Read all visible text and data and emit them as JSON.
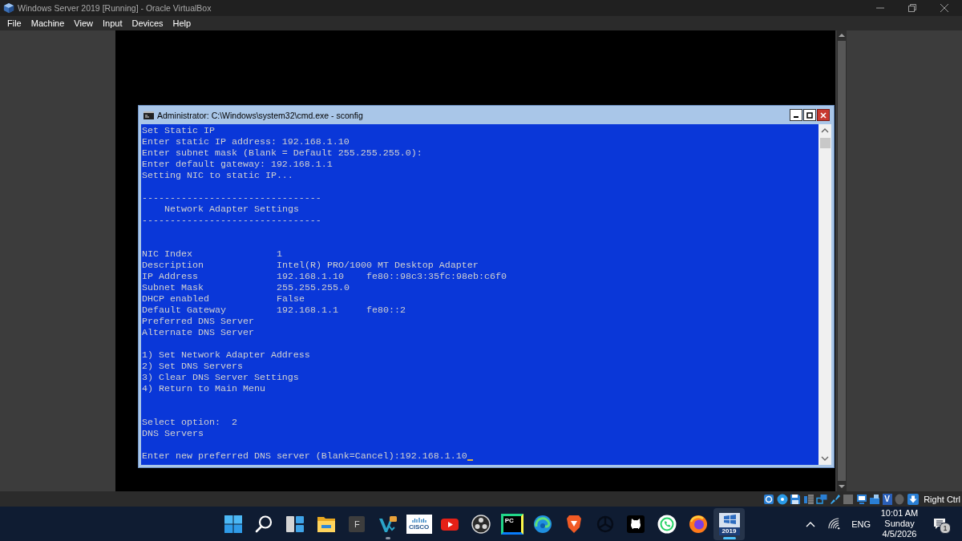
{
  "window": {
    "title": "Windows Server 2019 [Running] - Oracle VirtualBox"
  },
  "menu": [
    "File",
    "Machine",
    "View",
    "Input",
    "Devices",
    "Help"
  ],
  "console_window": {
    "title": "Administrator: C:\\Windows\\system32\\cmd.exe - sconfig",
    "intro_lines": [
      "Set Static IP",
      "Enter static IP address: 192.168.1.10",
      "Enter subnet mask (Blank = Default 255.255.255.0):",
      "Enter default gateway: 192.168.1.1",
      "Setting NIC to static IP..."
    ],
    "section": {
      "rule_top": "--------------------------------",
      "heading": "Network Adapter Settings",
      "rule_bottom": "--------------------------------"
    },
    "settings": [
      {
        "label": "NIC Index",
        "values": [
          "1"
        ]
      },
      {
        "label": "Description",
        "values": [
          "Intel(R) PRO/1000 MT Desktop Adapter"
        ]
      },
      {
        "label": "IP Address",
        "values": [
          "192.168.1.10",
          "fe80::98c3:35fc:98eb:c6f0"
        ]
      },
      {
        "label": "Subnet Mask",
        "values": [
          "255.255.255.0"
        ]
      },
      {
        "label": "DHCP enabled",
        "values": [
          "False"
        ]
      },
      {
        "label": "Default Gateway",
        "values": [
          "192.168.1.1",
          "fe80::2"
        ]
      },
      {
        "label": "Preferred DNS Server"
      },
      {
        "label": "Alternate DNS Server"
      }
    ],
    "options": [
      "1) Set Network Adapter Address",
      "2) Set DNS Servers",
      "3) Clear DNS Server Settings",
      "4) Return to Main Menu"
    ],
    "prompt_lines": [
      "Select option:  2",
      "DNS Servers"
    ],
    "input": {
      "prompt": "Enter new preferred DNS server (Blank=Cancel):",
      "value": "192.168.1.10"
    }
  },
  "status_bar": {
    "icons": [
      {
        "kind": "disk"
      },
      {
        "kind": "disc"
      },
      {
        "kind": "floppy"
      },
      {
        "kind": "speaker"
      },
      {
        "kind": "screens"
      },
      {
        "kind": "plug"
      },
      {
        "kind": "square"
      },
      {
        "kind": "monitor"
      },
      {
        "kind": "folder"
      },
      {
        "kind": "letter",
        "glyph": "V"
      },
      {
        "kind": "mouse"
      },
      {
        "kind": "down-arrow"
      }
    ],
    "host_key": "Right Ctrl"
  },
  "taskbar": {
    "apps": [
      {
        "kind": "start",
        "running": false,
        "active": false
      },
      {
        "kind": "search",
        "running": false,
        "active": false
      },
      {
        "kind": "panels",
        "running": false,
        "active": false
      },
      {
        "kind": "folder",
        "running": false,
        "active": false
      },
      {
        "kind": "letter",
        "glyph": "F",
        "running": false,
        "active": false
      },
      {
        "kind": "chevrons",
        "running": true,
        "active": false
      },
      {
        "kind": "bars-logo",
        "glyph": "CISCO",
        "running": false,
        "active": false
      },
      {
        "kind": "play",
        "running": false,
        "active": false
      },
      {
        "kind": "ring",
        "running": false,
        "active": false
      },
      {
        "kind": "letter-frame",
        "glyph": "PC",
        "running": false,
        "active": false
      },
      {
        "kind": "swirl",
        "running": false,
        "active": false
      },
      {
        "kind": "shield",
        "running": false,
        "active": false
      },
      {
        "kind": "knot",
        "running": false,
        "active": false
      },
      {
        "kind": "cat",
        "running": false,
        "active": false
      },
      {
        "kind": "phone-bubble",
        "running": false,
        "active": false
      },
      {
        "kind": "flame-globe",
        "running": false,
        "active": false
      },
      {
        "kind": "server-tile",
        "glyph": "2019",
        "running": true,
        "active": true
      }
    ],
    "tray": {
      "language": "ENG",
      "time": "10:01 AM",
      "day": "Sunday",
      "date": "4/5/2026",
      "notifications": "1"
    }
  }
}
